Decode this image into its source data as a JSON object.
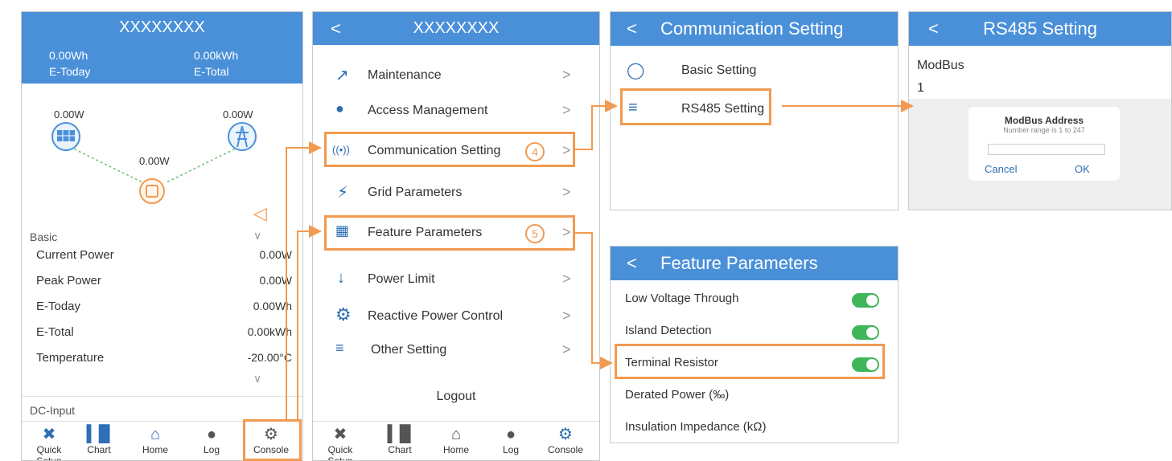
{
  "home": {
    "title": "XXXXXXXX",
    "e_today_value": "0.00Wh",
    "e_today_label": "E-Today",
    "e_total_value": "0.00kWh",
    "e_total_label": "E-Total",
    "pv_power": "0.00W",
    "grid_power": "0.00W",
    "inverter_power": "0.00W",
    "basic_label": "Basic",
    "rows": [
      {
        "label": "Current Power",
        "value": "0.00W"
      },
      {
        "label": "Peak Power",
        "value": "0.00W"
      },
      {
        "label": "E-Today",
        "value": "0.00Wh"
      },
      {
        "label": "E-Total",
        "value": "0.00kWh"
      },
      {
        "label": "Temperature",
        "value": "-20.00°C"
      }
    ],
    "dc_input_label": "DC-Input",
    "nav": [
      "Quick Setup",
      "Chart",
      "Home",
      "Log",
      "Console"
    ]
  },
  "console": {
    "title": "XXXXXXXX",
    "back": "<",
    "items": [
      {
        "label": "Maintenance"
      },
      {
        "label": "Access Management"
      },
      {
        "label": "Communication Setting",
        "step": "4"
      },
      {
        "label": "Grid Parameters"
      },
      {
        "label": "Feature Parameters",
        "step": "5"
      },
      {
        "label": "Power Limit"
      },
      {
        "label": "Reactive Power Control"
      },
      {
        "label": "Other Setting"
      }
    ],
    "chevron": ">",
    "logout": "Logout",
    "nav": [
      "Quick Setup",
      "Chart",
      "Home",
      "Log",
      "Console"
    ]
  },
  "comm": {
    "title": "Communication Setting",
    "back": "<",
    "items": [
      "Basic Setting",
      "RS485 Setting"
    ]
  },
  "rs485": {
    "title": "RS485 Setting",
    "back": "<",
    "modbus_label": "ModBus",
    "modbus_value": "1",
    "dialog_title": "ModBus Address",
    "dialog_hint": "Number range is 1 to 247",
    "cancel": "Cancel",
    "ok": "OK"
  },
  "feature": {
    "title": "Feature Parameters",
    "back": "<",
    "items": [
      {
        "label": "Low Voltage Through",
        "toggle": true
      },
      {
        "label": "Island Detection",
        "toggle": true
      },
      {
        "label": "Terminal Resistor",
        "toggle": true
      },
      {
        "label": "Derated Power (‰)",
        "toggle": false
      },
      {
        "label": "Insulation Impedance (kΩ)",
        "toggle": false
      }
    ]
  },
  "colors": {
    "accent": "#4a90d9",
    "highlight": "#f19a50",
    "toggle_on": "#3fb65a"
  }
}
